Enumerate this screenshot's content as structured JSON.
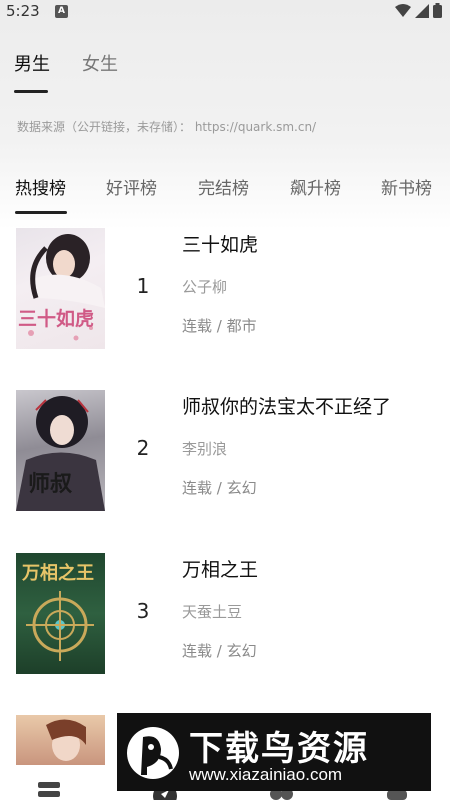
{
  "status_bar": {
    "time": "5:23",
    "notification_badge": "A"
  },
  "gender_tabs": [
    {
      "label": "男生",
      "active": true
    },
    {
      "label": "女生",
      "active": false
    }
  ],
  "source_notice": "数据来源（公开链接，未存储）： https://quark.sm.cn/",
  "rank_tabs": [
    {
      "label": "热搜榜",
      "active": true
    },
    {
      "label": "好评榜",
      "active": false
    },
    {
      "label": "完结榜",
      "active": false
    },
    {
      "label": "飙升榜",
      "active": false
    },
    {
      "label": "新书榜",
      "active": false
    }
  ],
  "books": [
    {
      "rank": "1",
      "title": "三十如虎",
      "author": "公子柳",
      "meta": "连载 / 都市",
      "cover_text": "三十如虎"
    },
    {
      "rank": "2",
      "title": "师叔你的法宝太不正经了",
      "author": "李别浪",
      "meta": "连载 / 玄幻",
      "cover_text": "师叔"
    },
    {
      "rank": "3",
      "title": "万相之王",
      "author": "天蚕土豆",
      "meta": "连载 / 玄幻",
      "cover_text": "万相之王"
    }
  ],
  "watermark": {
    "title": "下载鸟资源",
    "url": "www.xiazainiao.com"
  },
  "colors": {
    "active_text": "#111111",
    "inactive_text": "#777777",
    "muted_text": "#9a9a9a"
  }
}
